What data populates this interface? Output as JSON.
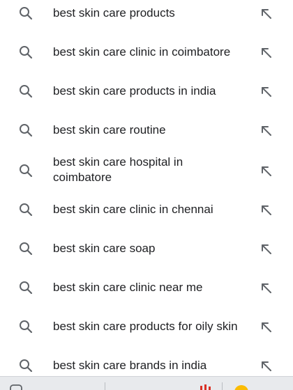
{
  "suggestions": [
    {
      "text": "best skin care products"
    },
    {
      "text": "best skin care clinic in coimbatore"
    },
    {
      "text": "best skin care products in india"
    },
    {
      "text": "best skin care routine"
    },
    {
      "text": "best skin care hospital in coimbatore"
    },
    {
      "text": "best skin care clinic in chennai"
    },
    {
      "text": "best skin care soap"
    },
    {
      "text": "best skin care clinic near me"
    },
    {
      "text": "best skin care products for oily skin"
    },
    {
      "text": "best skin care brands in india"
    }
  ],
  "icons": {
    "leading": "search-icon",
    "trailing": "arrow-up-left-icon"
  },
  "colors": {
    "text": "#202124",
    "icon": "#5f6368",
    "background": "#ffffff",
    "keyboard_strip": "#e8eaed",
    "accent_red": "#d93025",
    "emoji_yellow": "#fbbc04"
  }
}
